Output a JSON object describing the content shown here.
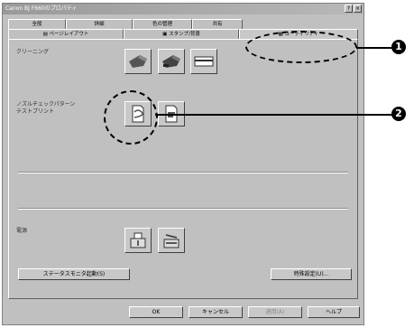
{
  "window": {
    "title": "Canon BJ F660のプロパティ",
    "help_btn": "?",
    "close_btn": "×"
  },
  "tabs_back": [
    {
      "label": "全般"
    },
    {
      "label": "詳細"
    },
    {
      "label": "色の管理"
    },
    {
      "label": "共有"
    }
  ],
  "tabs_front": [
    {
      "label": "ページレイアウト"
    },
    {
      "label": "スタンプ/背景"
    },
    {
      "label": "ユーティリティ"
    }
  ],
  "groups": {
    "cleaning_label": "クリーニング",
    "nozzle_label": "ノズルチェックパターン\nテストプリント",
    "power_label": "電源"
  },
  "buttons": {
    "status_monitor": "ステータスモニタ起動(S)",
    "special_settings": "特殊設定(U)...",
    "ok": "OK",
    "cancel": "キャンセル",
    "apply": "適用(A)",
    "help": "ヘルプ"
  },
  "callouts": [
    "1",
    "2"
  ],
  "colors": {
    "window_bg": "#c0c0c0",
    "titlebar": "#a8a8a8",
    "callout": "#000000"
  },
  "icons": [
    "cleaning-icon",
    "deep-cleaning-icon",
    "paper-feed-icon",
    "nozzle-check-icon",
    "test-print-icon",
    "power-off-icon",
    "power-on-icon"
  ]
}
